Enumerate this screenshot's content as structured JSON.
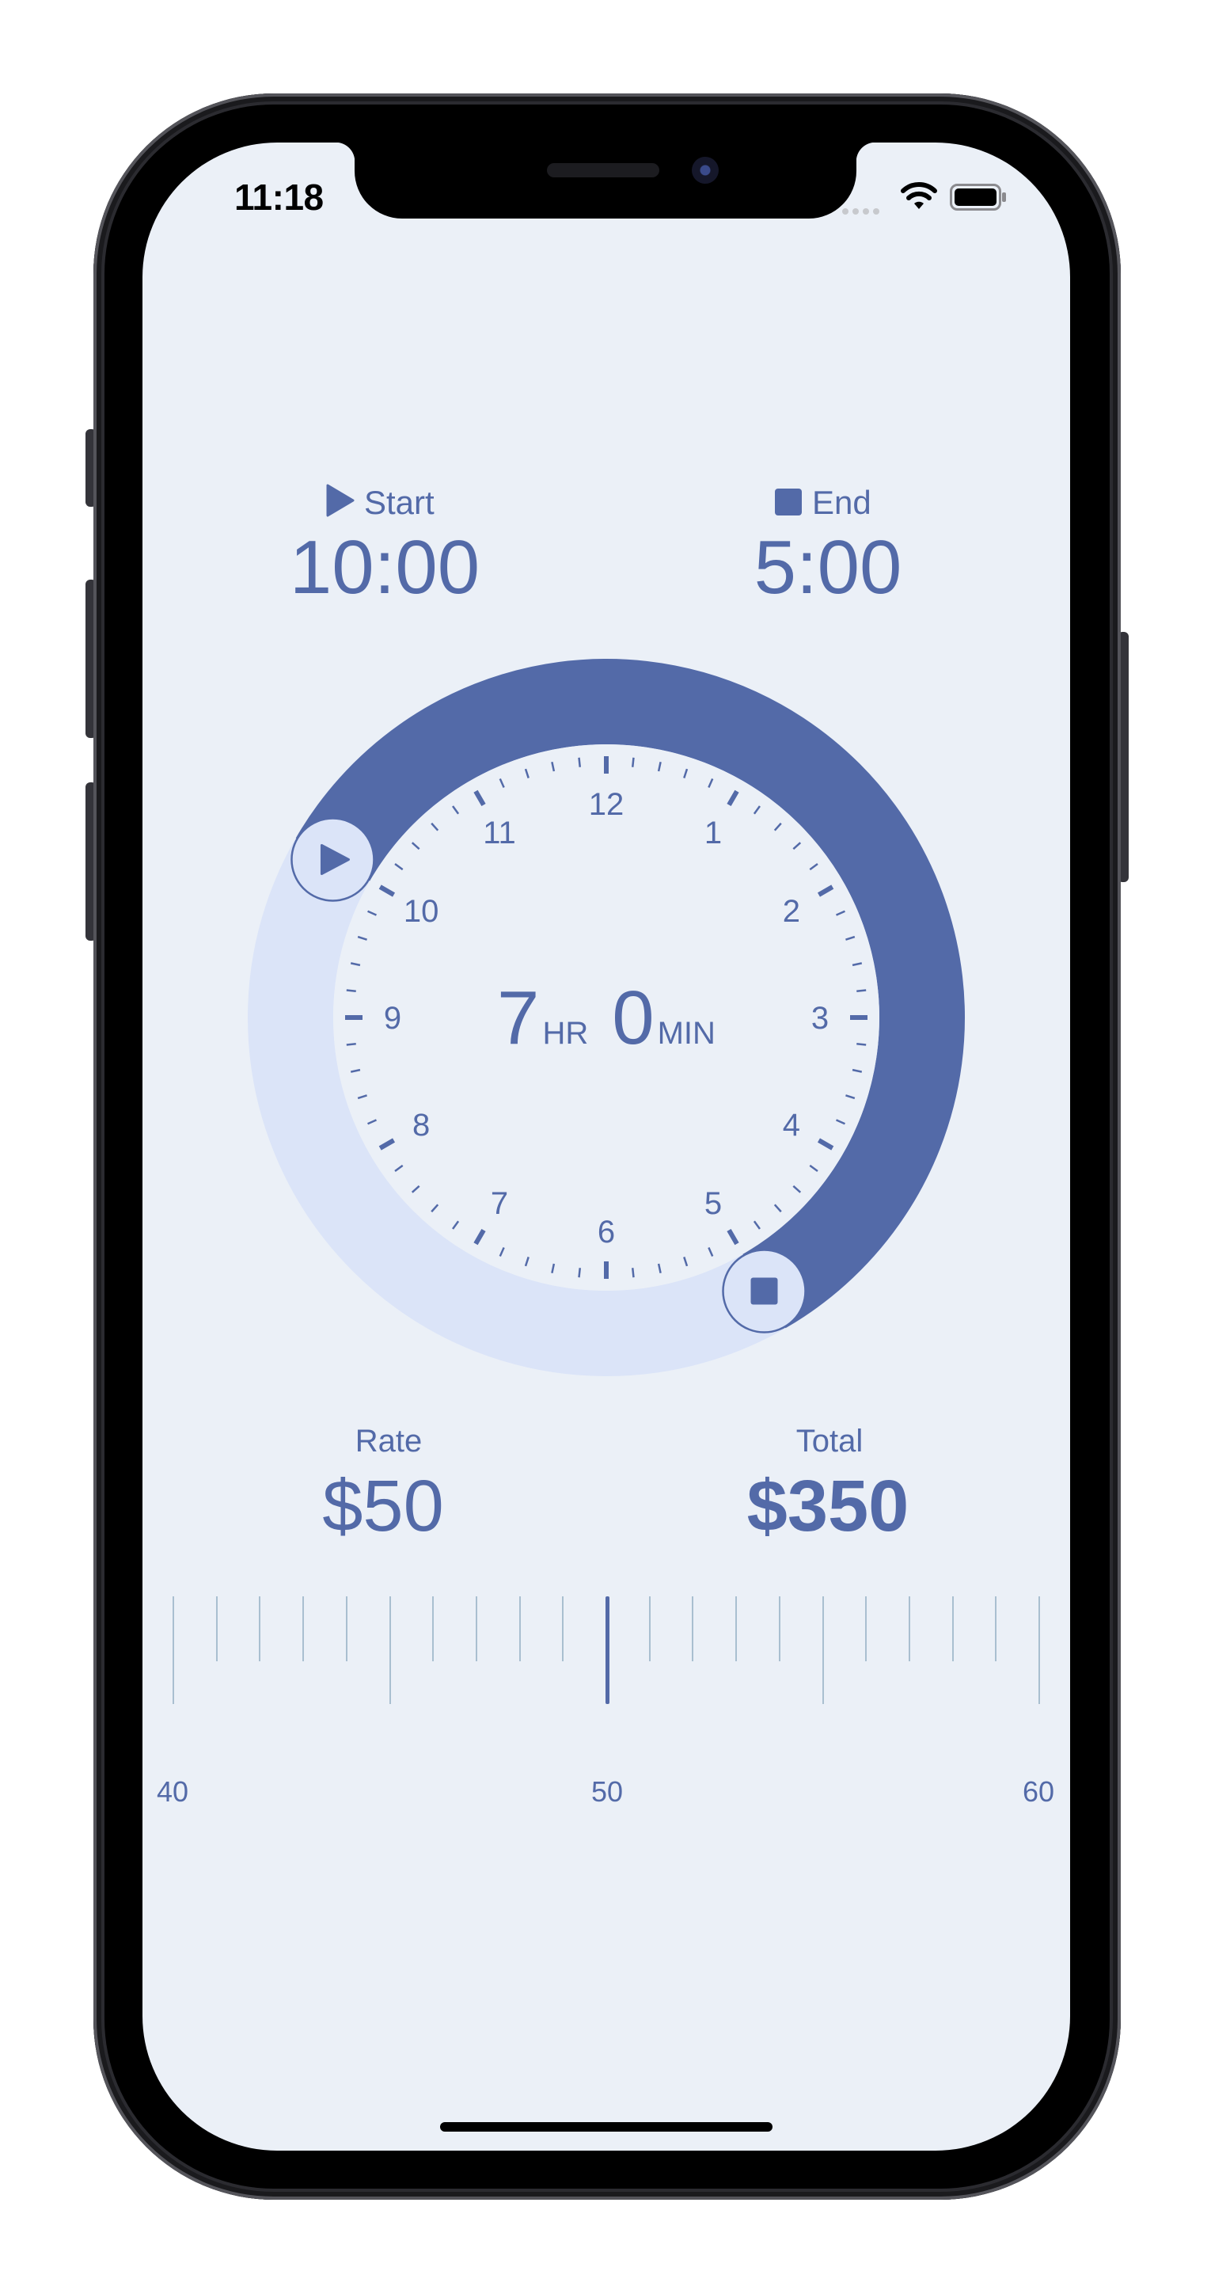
{
  "status_bar": {
    "time": "11:18"
  },
  "start": {
    "label": "Start",
    "time": "10:00",
    "icon": "play-icon"
  },
  "end": {
    "label": "End",
    "time": "5:00",
    "icon": "stop-icon"
  },
  "dial": {
    "hour_numbers": [
      "12",
      "1",
      "2",
      "3",
      "4",
      "5",
      "6",
      "7",
      "8",
      "9",
      "10",
      "11"
    ],
    "duration_hours": "7",
    "hours_unit": "HR",
    "duration_minutes": "0",
    "minutes_unit": "MIN",
    "start_handle_icon": "play-icon",
    "end_handle_icon": "stop-icon",
    "selected_start_hour": 10,
    "selected_end_hour": 5
  },
  "rate": {
    "label": "Rate",
    "value": "$50"
  },
  "total": {
    "label": "Total",
    "value": "$350"
  },
  "rate_ruler": {
    "labels": [
      "40",
      "50",
      "60"
    ],
    "selected": 50
  },
  "colors": {
    "accent": "#536aa8",
    "track": "#dbe4f8",
    "background": "#ebf0f7",
    "ruler_tick": "#a9bfd0"
  }
}
